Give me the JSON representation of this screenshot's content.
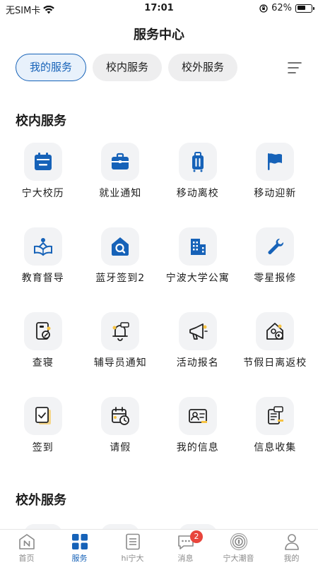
{
  "status_bar": {
    "carrier": "无SIM卡",
    "time": "17:01",
    "battery": "62%",
    "battery_level": 0.62
  },
  "page_title": "服务中心",
  "tabs": [
    {
      "label": "我的服务",
      "active": true
    },
    {
      "label": "校内服务",
      "active": false
    },
    {
      "label": "校外服务",
      "active": false
    }
  ],
  "sections": {
    "campus": {
      "title": "校内服务",
      "items": [
        {
          "label": "宁大校历",
          "icon": "calendar-icon"
        },
        {
          "label": "就业通知",
          "icon": "briefcase-icon"
        },
        {
          "label": "移动离校",
          "icon": "luggage-icon"
        },
        {
          "label": "移动迎新",
          "icon": "flag-icon"
        },
        {
          "label": "教育督导",
          "icon": "open-book-icon"
        },
        {
          "label": "蓝牙签到2",
          "icon": "home-search-icon"
        },
        {
          "label": "宁波大学公寓",
          "icon": "apartment-icon"
        },
        {
          "label": "零星报修",
          "icon": "repair-tool-icon"
        },
        {
          "label": "查寝",
          "icon": "dorm-check-icon"
        },
        {
          "label": "辅导员通知",
          "icon": "notice-bell-icon"
        },
        {
          "label": "活动报名",
          "icon": "megaphone-icon"
        },
        {
          "label": "节假日离返校",
          "icon": "house-return-icon"
        },
        {
          "label": "签到",
          "icon": "check-document-icon"
        },
        {
          "label": "请假",
          "icon": "leave-calendar-icon"
        },
        {
          "label": "我的信息",
          "icon": "id-card-icon"
        },
        {
          "label": "信息收集",
          "icon": "form-collect-icon"
        }
      ]
    },
    "external": {
      "title": "校外服务"
    }
  },
  "bottom_nav": [
    {
      "label": "首页",
      "icon": "home-logo-icon",
      "active": false
    },
    {
      "label": "服务",
      "icon": "grid-icon",
      "active": true
    },
    {
      "label": "hi宁大",
      "icon": "news-icon",
      "active": false
    },
    {
      "label": "消息",
      "icon": "message-icon",
      "active": false,
      "badge": "2"
    },
    {
      "label": "宁大潮音",
      "icon": "radio-icon",
      "active": false
    },
    {
      "label": "我的",
      "icon": "user-icon",
      "active": false
    }
  ],
  "colors": {
    "accent": "#1662b8",
    "icon_bg": "#f2f3f5",
    "badge": "#e8453c",
    "highlight": "#f6c343"
  }
}
